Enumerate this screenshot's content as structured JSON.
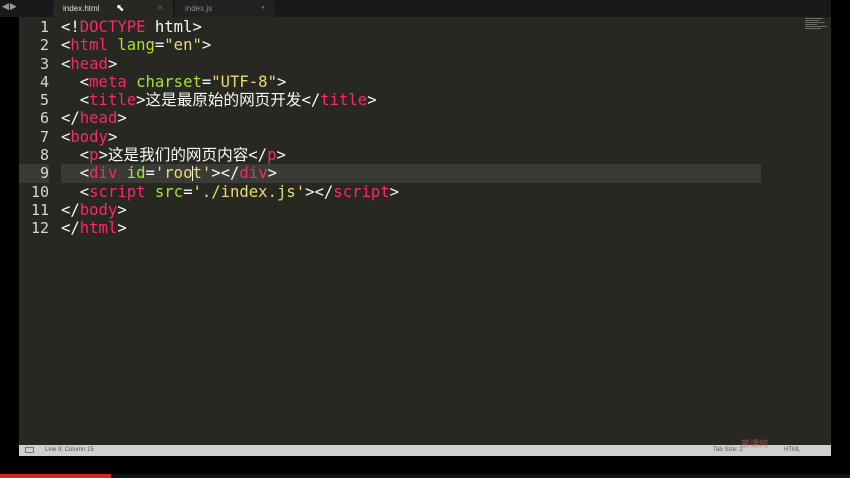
{
  "tabs": [
    {
      "label": "index.html",
      "active": true
    },
    {
      "label": "index.js",
      "active": false
    }
  ],
  "editor": {
    "line_numbers": [
      "1",
      "2",
      "3",
      "4",
      "5",
      "6",
      "7",
      "8",
      "9",
      "10",
      "11",
      "12"
    ],
    "active_line": 9,
    "lines": [
      [
        {
          "c": "p",
          "v": "<!"
        },
        {
          "c": "t",
          "v": "DOCTYPE"
        },
        {
          "c": "p",
          "v": " html>"
        }
      ],
      [
        {
          "c": "p",
          "v": "<"
        },
        {
          "c": "t",
          "v": "html"
        },
        {
          "c": "p",
          "v": " "
        },
        {
          "c": "a",
          "v": "lang"
        },
        {
          "c": "p",
          "v": "="
        },
        {
          "c": "s",
          "v": "\"en\""
        },
        {
          "c": "p",
          "v": ">"
        }
      ],
      [
        {
          "c": "p",
          "v": "<"
        },
        {
          "c": "t",
          "v": "head"
        },
        {
          "c": "p",
          "v": ">"
        }
      ],
      [
        {
          "c": "p",
          "v": "  <"
        },
        {
          "c": "t",
          "v": "meta"
        },
        {
          "c": "p",
          "v": " "
        },
        {
          "c": "a",
          "v": "charset"
        },
        {
          "c": "p",
          "v": "="
        },
        {
          "c": "s",
          "v": "\"UTF-8\""
        },
        {
          "c": "p",
          "v": ">"
        }
      ],
      [
        {
          "c": "p",
          "v": "  <"
        },
        {
          "c": "t",
          "v": "title"
        },
        {
          "c": "p",
          "v": ">这是最原始的网页开发</"
        },
        {
          "c": "t",
          "v": "title"
        },
        {
          "c": "p",
          "v": ">"
        }
      ],
      [
        {
          "c": "p",
          "v": "</"
        },
        {
          "c": "t",
          "v": "head"
        },
        {
          "c": "p",
          "v": ">"
        }
      ],
      [
        {
          "c": "p",
          "v": "<"
        },
        {
          "c": "t",
          "v": "body"
        },
        {
          "c": "p",
          "v": ">"
        }
      ],
      [
        {
          "c": "p",
          "v": "  <"
        },
        {
          "c": "t",
          "v": "p"
        },
        {
          "c": "p",
          "v": ">这是我们的网页内容</"
        },
        {
          "c": "t",
          "v": "p"
        },
        {
          "c": "p",
          "v": ">"
        }
      ],
      [
        {
          "c": "p",
          "v": "  <"
        },
        {
          "c": "t",
          "v": "div"
        },
        {
          "c": "p",
          "v": " "
        },
        {
          "c": "a",
          "v": "id"
        },
        {
          "c": "p",
          "v": "="
        },
        {
          "c": "s",
          "v": "'roo"
        },
        {
          "c": "caret",
          "v": ""
        },
        {
          "c": "s",
          "v": "t'"
        },
        {
          "c": "p",
          "v": "></"
        },
        {
          "c": "t",
          "v": "div"
        },
        {
          "c": "p",
          "v": ">"
        }
      ],
      [
        {
          "c": "p",
          "v": "  <"
        },
        {
          "c": "t",
          "v": "script"
        },
        {
          "c": "p",
          "v": " "
        },
        {
          "c": "a",
          "v": "src"
        },
        {
          "c": "p",
          "v": "="
        },
        {
          "c": "s",
          "v": "'./index.js'"
        },
        {
          "c": "p",
          "v": "></"
        },
        {
          "c": "t",
          "v": "script"
        },
        {
          "c": "p",
          "v": ">"
        }
      ],
      [
        {
          "c": "p",
          "v": "</"
        },
        {
          "c": "t",
          "v": "body"
        },
        {
          "c": "p",
          "v": ">"
        }
      ],
      [
        {
          "c": "p",
          "v": "</"
        },
        {
          "c": "t",
          "v": "html"
        },
        {
          "c": "p",
          "v": ">"
        }
      ]
    ]
  },
  "status": {
    "position": "Line 9, Column 15",
    "tab_size": "Tab Size: 2",
    "syntax": "HTML"
  },
  "watermark": "慕课网",
  "video_progress": 0.13,
  "icons": {
    "nav_back": "◀",
    "nav_forward": "▶",
    "close": "✕",
    "dirty": "●",
    "pointer": "⬉"
  }
}
